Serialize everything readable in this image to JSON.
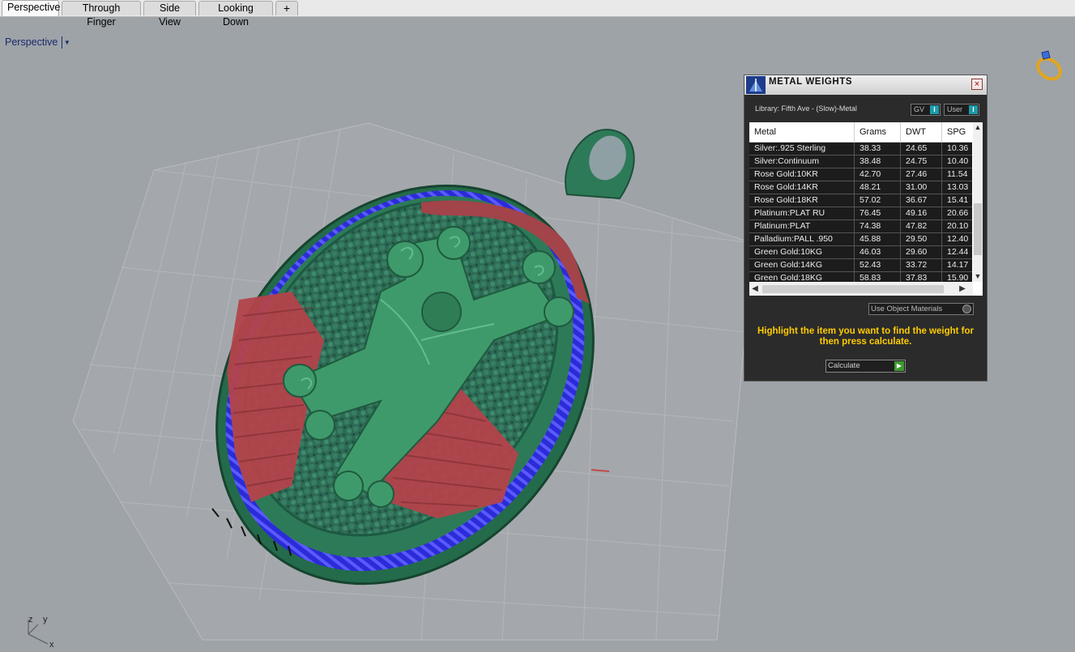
{
  "tabs": [
    "Perspective",
    "Through Finger",
    "Side View",
    "Looking Down",
    "+"
  ],
  "active_tab": "Perspective",
  "viewport": {
    "label": "Perspective"
  },
  "axis": {
    "z": "z",
    "y": "y",
    "x": "x"
  },
  "panel": {
    "title": "METAL WEIGHTS",
    "library": "Library: Fifth Ave - (Slow)-Metal",
    "gv_label": "GV",
    "user_label": "User",
    "columns": [
      "Metal",
      "Grams",
      "DWT",
      "SPG"
    ],
    "rows": [
      [
        "Silver:.925 Sterling",
        "38.33",
        "24.65",
        "10.36"
      ],
      [
        "Silver:Continuum",
        "38.48",
        "24.75",
        "10.40"
      ],
      [
        "Rose Gold:10KR",
        "42.70",
        "27.46",
        "11.54"
      ],
      [
        "Rose Gold:14KR",
        "48.21",
        "31.00",
        "13.03"
      ],
      [
        "Rose Gold:18KR",
        "57.02",
        "36.67",
        "15.41"
      ],
      [
        "Platinum:PLAT RU",
        "76.45",
        "49.16",
        "20.66"
      ],
      [
        "Platinum:PLAT",
        "74.38",
        "47.82",
        "20.10"
      ],
      [
        "Palladium:PALL .950",
        "45.88",
        "29.50",
        "12.40"
      ],
      [
        "Green Gold:10KG",
        "46.03",
        "29.60",
        "12.44"
      ],
      [
        "Green Gold:14KG",
        "52.43",
        "33.72",
        "14.17"
      ],
      [
        "Green Gold:18KG",
        "58.83",
        "37.83",
        "15.90"
      ]
    ],
    "use_object_materials": "Use Object Materials",
    "hint": "Highlight the item you want to find the weight for then press calculate.",
    "calculate": "Calculate"
  }
}
